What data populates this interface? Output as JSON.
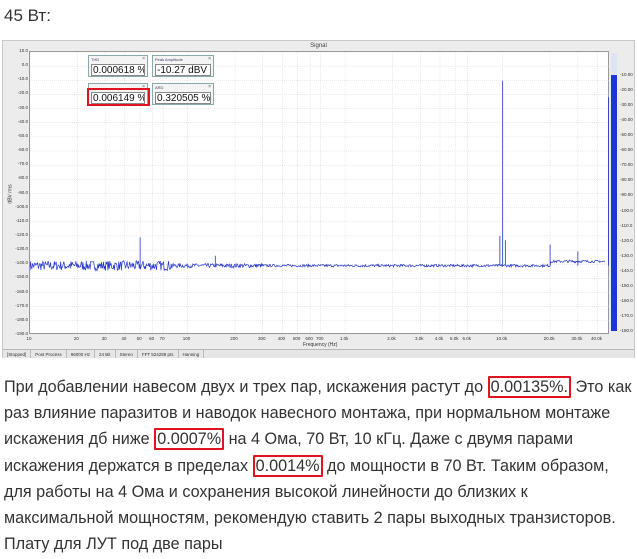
{
  "heading": "45 Вт:",
  "window_title": "Signal",
  "meters": {
    "thd": {
      "caption": "THD",
      "value": "0.000618 %"
    },
    "peak": {
      "caption": "Peak Amplitude",
      "value": "-10.27 dBV r"
    },
    "thdn": {
      "caption": "",
      "value": "0.006149 %"
    },
    "ard": {
      "caption": "ARD",
      "value": "0.320505 %"
    }
  },
  "y_axis_left": [
    "10.0",
    "0.0",
    "-10.0",
    "-20.0",
    "-30.0",
    "-40.0",
    "-50.0",
    "-60.0",
    "-70.0",
    "-80.0",
    "-90.0",
    "-100.0",
    "-110.0",
    "-120.0",
    "-130.0",
    "-140.0",
    "-150.0",
    "-160.0",
    "-170.0",
    "-180.0",
    "-190.0"
  ],
  "y_axis_right": [
    "-10.00",
    "-20.00",
    "-30.00",
    "-40.00",
    "-50.00",
    "-60.00",
    "-70.00",
    "-80.00",
    "-90.00",
    "-100.0",
    "-110.0",
    "-120.0",
    "-130.0",
    "-140.0",
    "-150.0",
    "-160.0",
    "-170.0",
    "-180.0"
  ],
  "y_label": "dBV rms",
  "x_axis": [
    "10",
    "20",
    "30",
    "40",
    "50",
    "60",
    "70",
    "100",
    "200",
    "300",
    "400",
    "500",
    "600",
    "700",
    "1.0k",
    "2.0k",
    "3.0k",
    "4.0k",
    "5.0k",
    "6.0k",
    "10.0k",
    "20.0k",
    "30.0k",
    "40.0k"
  ],
  "x_label": "Frequency (Hz)",
  "status_bar": [
    "[Stopped]",
    "Post Process",
    "96000 Hz",
    "24 Bit",
    "Stereo",
    "FFT 524288 pts",
    "Hanning"
  ],
  "paragraph": {
    "t1": "При добавлении навесом двух и трех пар, искажения растут до ",
    "h1": "0.00135%.",
    "t2": " Это как раз влияние паразитов и наводок навесного монтажа, при нормальном монтаже искажения дб ниже ",
    "h2": "0.0007%",
    "t3": " на 4 Ома, 70 Вт, 10 кГц. Даже с двумя парами искажения держатся в пределах ",
    "h3": "0.0014%",
    "t4": " до мощности в 70 Вт. Таким образом, для работы на 4 Ома и сохранения высокой линейности до близких к максимальной мощностям, рекомендую ставить 2 пары выходных транзисторов. Плату для ЛУТ под две пары"
  },
  "colors": {
    "trace": "#2233cc",
    "highlight": "#e0141e",
    "meter_bar": "#1b37d6"
  }
}
